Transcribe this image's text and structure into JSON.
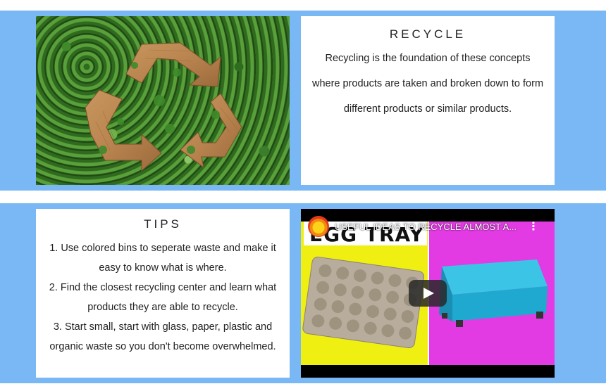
{
  "recycle": {
    "title": "RECYCLE",
    "lines": [
      "Recycling is the foundation of these concepts",
      "where products are taken and broken down to form",
      "different products or similar products."
    ]
  },
  "tips": {
    "title": "TIPS",
    "items": [
      "1. Use colored bins to seperate waste and make it easy to know what is where.",
      "2. Find the closest recycling center and learn what products they are able to recycle.",
      "3. Start small, start with glass, paper, plastic and organic waste so you don't become overwhelmed."
    ]
  },
  "video": {
    "title": "USEFUL IDEAS TO RECYCLE ALMOST A...",
    "overlay_text": "EGG TRAY",
    "menu_symbol": "⋮"
  },
  "colors": {
    "band": "#7ab8f5",
    "card_bg": "#ffffff",
    "video_left": "#f0ef12",
    "video_right": "#e23be3",
    "ottoman": "#1fa9d0"
  }
}
